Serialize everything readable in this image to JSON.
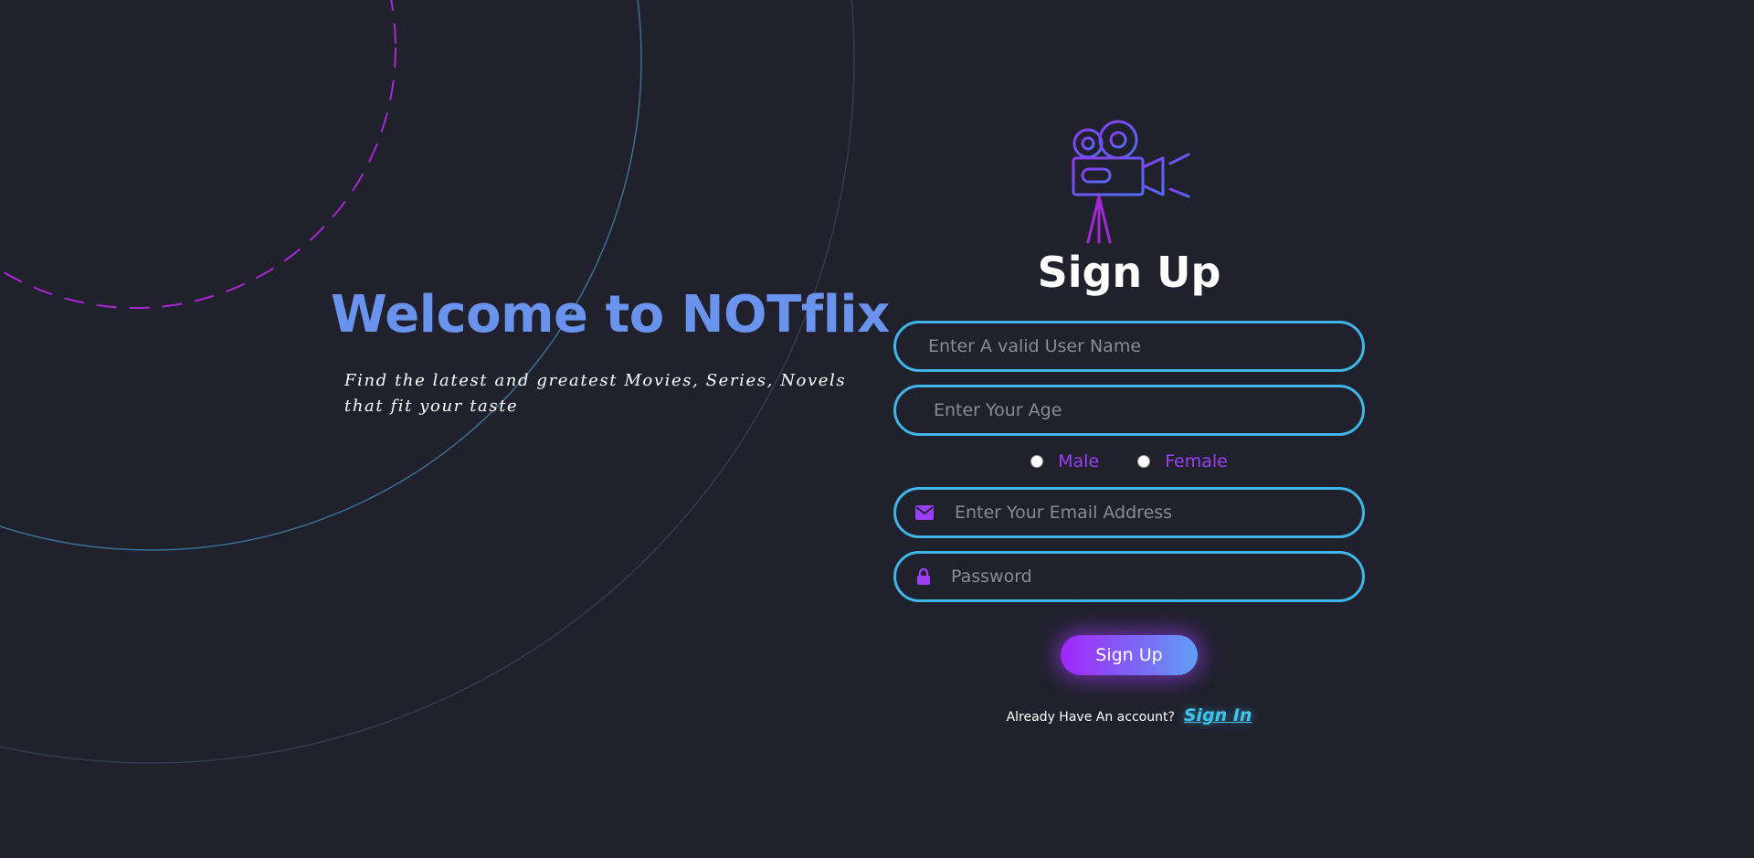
{
  "hero": {
    "title": "Welcome to NOTflix",
    "subtitle": "Find the latest and greatest Movies, Series,  Novels that fit your taste"
  },
  "form": {
    "title": "Sign Up",
    "logo_icon": "movie-camera-icon",
    "username_placeholder": "Enter A valid User Name",
    "age_placeholder": "Enter Your Age",
    "gender_options": [
      "Male",
      "Female"
    ],
    "email_placeholder": "Enter Your Email Address",
    "email_icon": "envelope-icon",
    "password_placeholder": "Password",
    "password_icon": "lock-icon",
    "submit_label": "Sign Up",
    "signin_prompt": "Already Have An account?",
    "signin_link": "Sign In"
  },
  "colors": {
    "background": "#21212d",
    "accent_blue": "#3fb6e8",
    "accent_purple": "#9b3ff6",
    "title_blue": "#6a93ee"
  }
}
